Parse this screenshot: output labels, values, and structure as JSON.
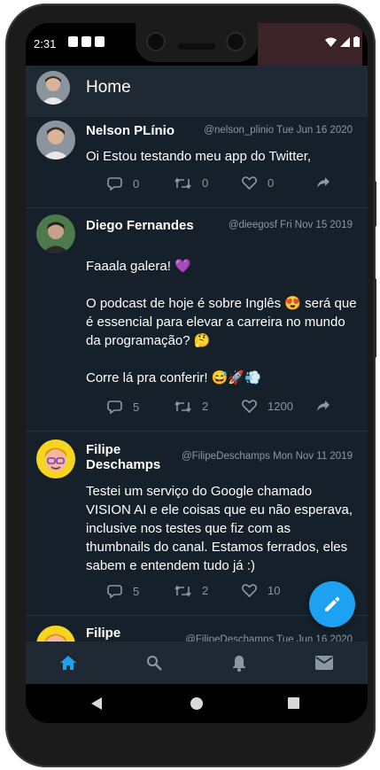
{
  "status": {
    "time": "2:31"
  },
  "header": {
    "title": "Home"
  },
  "tweets": [
    {
      "name": "Nelson PLínio",
      "handle": "@nelson_plinio",
      "date": "Tue Jun 16 2020",
      "text": "Oi Estou testando meu app do Twitter,",
      "replies": "0",
      "retweets": "0",
      "likes": "0"
    },
    {
      "name": "Diego Fernandes",
      "handle": "@dieegosf",
      "date": "Fri Nov 15 2019",
      "text": "Faaala galera! 💜\n\nO podcast de hoje é sobre Inglês 😍 será que é essencial para elevar a carreira no mundo da programação? 🤔\n\nCorre lá pra conferir! 😅🚀💨",
      "replies": "5",
      "retweets": "2",
      "likes": "1200"
    },
    {
      "name": "Filipe Deschamps",
      "handle": "@FilipeDeschamps",
      "date": "Mon Nov 11 2019",
      "text": "Testei um serviço do Google chamado VISION AI e ele coisas que eu não esperava, inclusive nos testes que fiz com as thumbnails do canal. Estamos ferrados, eles sabem e entendem tudo já :)",
      "replies": "5",
      "retweets": "2",
      "likes": "10"
    },
    {
      "name": "Filipe",
      "handle": "@FilipeDeschamps",
      "date": "Tue Jun 16 2020"
    }
  ],
  "icons": {
    "nav": [
      "home-icon",
      "search-icon",
      "bell-icon",
      "mail-icon"
    ],
    "fab": "compose-icon"
  },
  "colors": {
    "background": "#15202b",
    "bar": "#1f2934",
    "accent": "#1da1f2",
    "muted": "#8a98a5"
  }
}
